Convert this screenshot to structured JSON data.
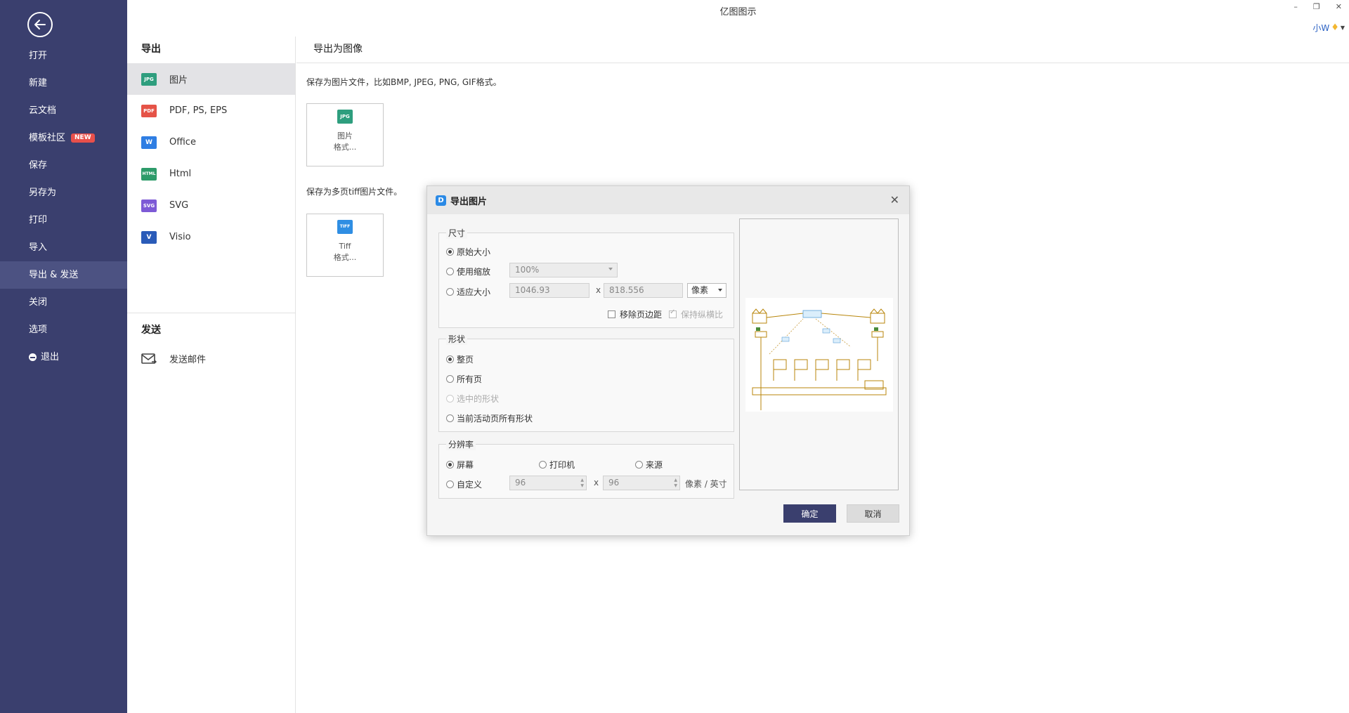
{
  "app": {
    "title": "亿图图示",
    "user": "小W"
  },
  "nav": {
    "items": [
      {
        "label": "打开"
      },
      {
        "label": "新建"
      },
      {
        "label": "云文档"
      },
      {
        "label": "模板社区",
        "badge": "NEW"
      },
      {
        "label": "保存"
      },
      {
        "label": "另存为"
      },
      {
        "label": "打印"
      },
      {
        "label": "导入"
      },
      {
        "label": "导出 & 发送"
      },
      {
        "label": "关闭"
      },
      {
        "label": "选项"
      },
      {
        "label": "退出"
      }
    ]
  },
  "export_panel": {
    "title": "导出",
    "items": [
      {
        "label": "图片",
        "icon": "JPG"
      },
      {
        "label": "PDF, PS, EPS",
        "icon": "PDF"
      },
      {
        "label": "Office",
        "icon": "W"
      },
      {
        "label": "Html",
        "icon": "HTML"
      },
      {
        "label": "SVG",
        "icon": "SVG"
      },
      {
        "label": "Visio",
        "icon": "V"
      }
    ],
    "send_title": "发送",
    "send_items": [
      {
        "label": "发送邮件"
      }
    ]
  },
  "content": {
    "title": "导出为图像",
    "desc1": "保存为图片文件，比如BMP, JPEG, PNG, GIF格式。",
    "card1": {
      "icon": "JPG",
      "line1": "图片",
      "line2": "格式..."
    },
    "desc2": "保存为多页tiff图片文件。",
    "card2": {
      "icon": "TIFF",
      "line1": "Tiff",
      "line2": "格式..."
    }
  },
  "dialog": {
    "title": "导出图片",
    "size_group": {
      "label": "尺寸",
      "original": "原始大小",
      "use_scale": "使用缩放",
      "scale_value": "100%",
      "fit_size": "适应大小",
      "width": "1046.93",
      "height": "818.556",
      "x": "x",
      "unit": "像素",
      "remove_margin": "移除页边距",
      "keep_ratio": "保持纵横比"
    },
    "shape_group": {
      "label": "形状",
      "whole_page": "整页",
      "all_pages": "所有页",
      "selected": "选中的形状",
      "active_page_all": "当前活动页所有形状"
    },
    "res_group": {
      "label": "分辨率",
      "screen": "屏幕",
      "printer": "打印机",
      "source": "来源",
      "custom": "自定义",
      "dpi_x": "96",
      "dpi_y": "96",
      "x": "x",
      "unit": "像素 / 英寸"
    },
    "ok": "确定",
    "cancel": "取消"
  },
  "colors": {
    "nav_bg": "#3a3f6e",
    "accent": "#3a3f6e",
    "badge": "#e8504b"
  }
}
